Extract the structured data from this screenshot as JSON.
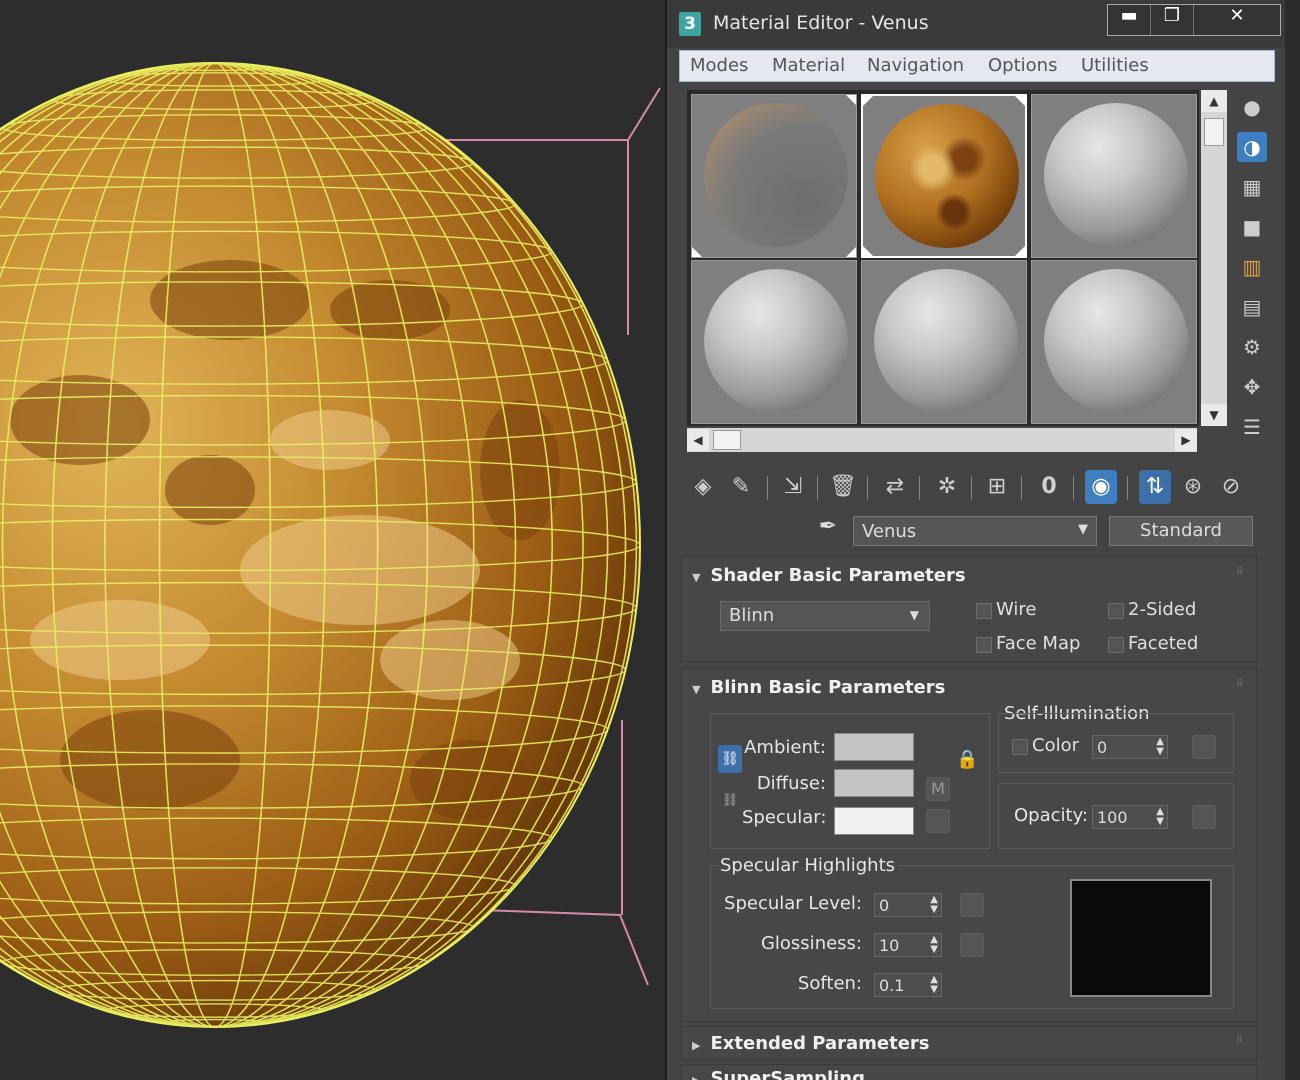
{
  "window": {
    "title": "Material Editor - Venus",
    "app_icon": "3",
    "controls": {
      "minimize": "▬",
      "maximize": "❐",
      "close": "✕"
    }
  },
  "menu": [
    "Modes",
    "Material",
    "Navigation",
    "Options",
    "Utilities"
  ],
  "material": {
    "name": "Venus",
    "type": "Standard"
  },
  "shader_rollout": {
    "title": "Shader Basic Parameters",
    "shader": "Blinn",
    "wire": "Wire",
    "two_sided": "2-Sided",
    "face_map": "Face Map",
    "faceted": "Faceted"
  },
  "blinn_rollout": {
    "title": "Blinn Basic Parameters",
    "ambient": "Ambient:",
    "diffuse": "Diffuse:",
    "specular": "Specular:",
    "map_button": "M",
    "self_illum_title": "Self-Illumination",
    "color_label": "Color",
    "self_illum_value": "0",
    "opacity_label": "Opacity:",
    "opacity_value": "100",
    "colors": {
      "ambient": "#c4c4c4",
      "diffuse": "#c4c4c4",
      "specular": "#f0f0f0",
      "highlight_preview": "#0a0a0a"
    }
  },
  "highlights": {
    "title": "Specular Highlights",
    "level_label": "Specular Level:",
    "level_value": "0",
    "gloss_label": "Glossiness:",
    "gloss_value": "10",
    "soften_label": "Soften:",
    "soften_value": "0.1"
  },
  "extended_rollout": {
    "title": "Extended Parameters"
  },
  "supersampling_rollout": {
    "title": "SuperSampling"
  },
  "icons": {
    "side": [
      "sphere-icon",
      "background-icon",
      "checker-icon",
      "box-icon",
      "color-bars-icon",
      "video-check-icon",
      "material-by-name-icon",
      "select-by-material-icon",
      "options-list-icon"
    ],
    "toolbar": [
      "get-material-icon",
      "put-to-scene-icon",
      "assign-to-selection-icon",
      "delete-icon",
      "make-unique-icon",
      "put-to-library-icon",
      "save-icon",
      "effects-channel-icon",
      "show-in-viewport-icon",
      "show-end-result-icon",
      "go-to-parent-icon",
      "go-forward-icon"
    ]
  }
}
